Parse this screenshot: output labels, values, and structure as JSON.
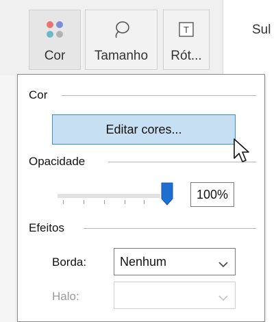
{
  "toolbar": {
    "color_label": "Cor",
    "size_label": "Tamanho",
    "label_label": "Rót...",
    "label_icon_glyph": "T",
    "shelf_text": "Sul"
  },
  "popup": {
    "color_section": "Cor",
    "edit_colors_label": "Editar cores...",
    "opacity_section": "Opacidade",
    "opacity_value": "100%",
    "opacity_fraction": 1.0,
    "effects_section": "Efeitos",
    "border_label": "Borda:",
    "border_value": "Nenhum",
    "halo_label": "Halo:",
    "halo_value": ""
  },
  "colors": {
    "accent": "#1f6fd1",
    "dot_colors": [
      "#e8736f",
      "#7b8fd6",
      "#6ab7c9",
      "#b3b3b3"
    ]
  },
  "icons": {
    "color": "color-dots-icon",
    "size": "size-lasso-icon",
    "label": "text-label-icon",
    "chevron": "chevron-down-icon",
    "cursor": "mouse-pointer-icon"
  }
}
